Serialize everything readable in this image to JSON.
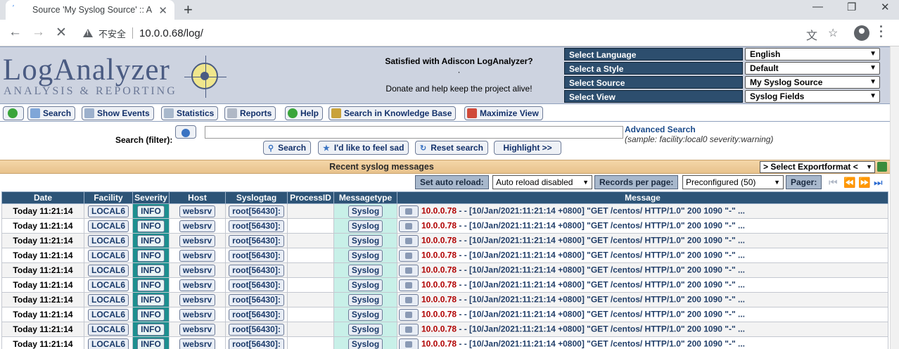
{
  "browser": {
    "tab_title": "Source 'My Syslog Source' :: A",
    "security_label": "不安全",
    "url": "10.0.0.68/log/"
  },
  "header": {
    "logo_main": "LogAnalyzer",
    "logo_sub": "ANALYSIS & REPORTING",
    "donate_question": "Satisfied with Adiscon LogAnalyzer?",
    "donate_dot": "·",
    "donate_text": "Donate and help keep the project alive!",
    "selectors": [
      {
        "label": "Select Language",
        "value": "English"
      },
      {
        "label": "Select a Style",
        "value": "Default"
      },
      {
        "label": "Select Source",
        "value": "My Syslog Source"
      },
      {
        "label": "Select View",
        "value": "Syslog Fields"
      }
    ]
  },
  "toolbar": {
    "search": "Search",
    "show_events": "Show Events",
    "statistics": "Statistics",
    "reports": "Reports",
    "help": "Help",
    "kb_search": "Search in Knowledge Base",
    "maximize": "Maximize View"
  },
  "search": {
    "label": "Search (filter):",
    "value": "",
    "advanced_link": "Advanced Search",
    "sample": "(sample: facility:local0 severity:warning)",
    "btn_search": "Search",
    "btn_feel_sad": "I'd like to feel sad",
    "btn_reset": "Reset search",
    "btn_highlight": "Highlight >>"
  },
  "recent": {
    "title": "Recent syslog messages",
    "export_label": "> Select Exportformat <"
  },
  "controls": {
    "auto_reload_btn": "Set auto reload:",
    "auto_reload_value": "Auto reload disabled",
    "records_btn": "Records per page:",
    "records_value": "Preconfigured (50)",
    "pager_btn": "Pager:"
  },
  "table": {
    "columns": [
      "Date",
      "Facility",
      "Severity",
      "Host",
      "Syslogtag",
      "ProcessID",
      "Messagetype",
      "Message"
    ],
    "rows": [
      {
        "date": "Today 11:21:14",
        "facility": "LOCAL6",
        "severity": "INFO",
        "host": "websrv",
        "tag": "root[56430]:",
        "pid": "",
        "type": "Syslog",
        "ip": "10.0.0.78",
        "msg": " - - [10/Jan/2021:11:21:14 +0800] \"GET /centos/ HTTP/1.0\" 200 1090 \"-\" ..."
      },
      {
        "date": "Today 11:21:14",
        "facility": "LOCAL6",
        "severity": "INFO",
        "host": "websrv",
        "tag": "root[56430]:",
        "pid": "",
        "type": "Syslog",
        "ip": "10.0.0.78",
        "msg": " - - [10/Jan/2021:11:21:14 +0800] \"GET /centos/ HTTP/1.0\" 200 1090 \"-\" ..."
      },
      {
        "date": "Today 11:21:14",
        "facility": "LOCAL6",
        "severity": "INFO",
        "host": "websrv",
        "tag": "root[56430]:",
        "pid": "",
        "type": "Syslog",
        "ip": "10.0.0.78",
        "msg": " - - [10/Jan/2021:11:21:14 +0800] \"GET /centos/ HTTP/1.0\" 200 1090 \"-\" ..."
      },
      {
        "date": "Today 11:21:14",
        "facility": "LOCAL6",
        "severity": "INFO",
        "host": "websrv",
        "tag": "root[56430]:",
        "pid": "",
        "type": "Syslog",
        "ip": "10.0.0.78",
        "msg": " - - [10/Jan/2021:11:21:14 +0800] \"GET /centos/ HTTP/1.0\" 200 1090 \"-\" ..."
      },
      {
        "date": "Today 11:21:14",
        "facility": "LOCAL6",
        "severity": "INFO",
        "host": "websrv",
        "tag": "root[56430]:",
        "pid": "",
        "type": "Syslog",
        "ip": "10.0.0.78",
        "msg": " - - [10/Jan/2021:11:21:14 +0800] \"GET /centos/ HTTP/1.0\" 200 1090 \"-\" ..."
      },
      {
        "date": "Today 11:21:14",
        "facility": "LOCAL6",
        "severity": "INFO",
        "host": "websrv",
        "tag": "root[56430]:",
        "pid": "",
        "type": "Syslog",
        "ip": "10.0.0.78",
        "msg": " - - [10/Jan/2021:11:21:14 +0800] \"GET /centos/ HTTP/1.0\" 200 1090 \"-\" ..."
      },
      {
        "date": "Today 11:21:14",
        "facility": "LOCAL6",
        "severity": "INFO",
        "host": "websrv",
        "tag": "root[56430]:",
        "pid": "",
        "type": "Syslog",
        "ip": "10.0.0.78",
        "msg": " - - [10/Jan/2021:11:21:14 +0800] \"GET /centos/ HTTP/1.0\" 200 1090 \"-\" ..."
      },
      {
        "date": "Today 11:21:14",
        "facility": "LOCAL6",
        "severity": "INFO",
        "host": "websrv",
        "tag": "root[56430]:",
        "pid": "",
        "type": "Syslog",
        "ip": "10.0.0.78",
        "msg": " - - [10/Jan/2021:11:21:14 +0800] \"GET /centos/ HTTP/1.0\" 200 1090 \"-\" ..."
      },
      {
        "date": "Today 11:21:14",
        "facility": "LOCAL6",
        "severity": "INFO",
        "host": "websrv",
        "tag": "root[56430]:",
        "pid": "",
        "type": "Syslog",
        "ip": "10.0.0.78",
        "msg": " - - [10/Jan/2021:11:21:14 +0800] \"GET /centos/ HTTP/1.0\" 200 1090 \"-\" ..."
      },
      {
        "date": "Today 11:21:14",
        "facility": "LOCAL6",
        "severity": "INFO",
        "host": "websrv",
        "tag": "root[56430]:",
        "pid": "",
        "type": "Syslog",
        "ip": "10.0.0.78",
        "msg": " - - [10/Jan/2021:11:21:14 +0800] \"GET /centos/ HTTP/1.0\" 200 1090 \"-\" ..."
      }
    ]
  }
}
